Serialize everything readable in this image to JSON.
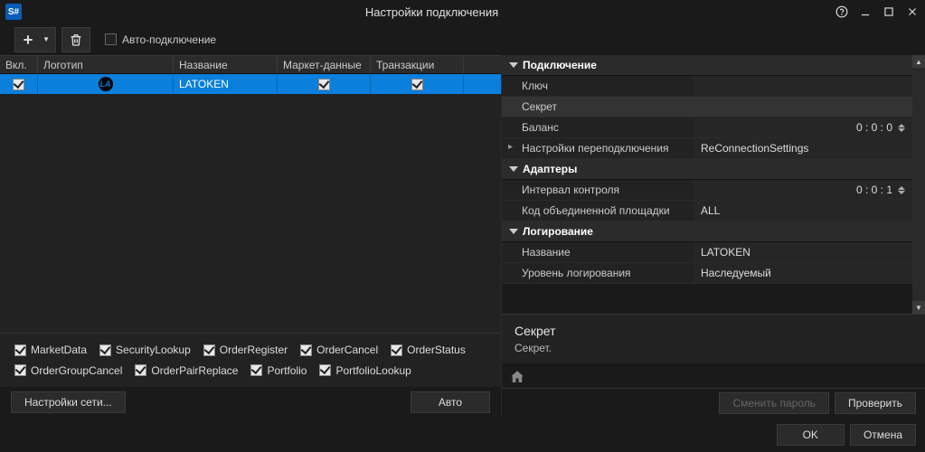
{
  "window": {
    "title": "Настройки подключения",
    "app_badge": "S#"
  },
  "toolbar": {
    "auto_connect_label": "Авто-подключение",
    "auto_connect_checked": false
  },
  "grid": {
    "columns": {
      "enabled": "Вкл.",
      "logo": "Логотип",
      "name": "Название",
      "market_data": "Маркет-данные",
      "transactions": "Транзакции"
    },
    "rows": [
      {
        "enabled": true,
        "name": "LATOKEN",
        "market_data": true,
        "transactions": true
      }
    ]
  },
  "features": [
    "MarketData",
    "SecurityLookup",
    "OrderRegister",
    "OrderCancel",
    "OrderStatus",
    "OrderGroupCancel",
    "OrderPairReplace",
    "Portfolio",
    "PortfolioLookup"
  ],
  "left_footer": {
    "network_settings": "Настройки сети...",
    "auto": "Авто"
  },
  "props": {
    "cat_connection": "Подключение",
    "key": "Ключ",
    "secret": "Секрет",
    "balance": "Баланс",
    "balance_val": "0 : 0 : 0",
    "reconnect": "Настройки переподключения",
    "reconnect_val": "ReConnectionSettings",
    "cat_adapters": "Адаптеры",
    "control_interval": "Интервал контроля",
    "control_interval_val": "0 : 0 : 1",
    "board_code": "Код объединенной площадки",
    "board_code_val": "ALL",
    "cat_logging": "Логирование",
    "log_name": "Название",
    "log_name_val": "LATOKEN",
    "log_level": "Уровень логирования",
    "log_level_val": "Наследуемый"
  },
  "desc": {
    "title": "Секрет",
    "text": "Секрет."
  },
  "right_footer": {
    "change_password": "Сменить пароль",
    "check": "Проверить",
    "ok": "OK",
    "cancel": "Отмена"
  }
}
